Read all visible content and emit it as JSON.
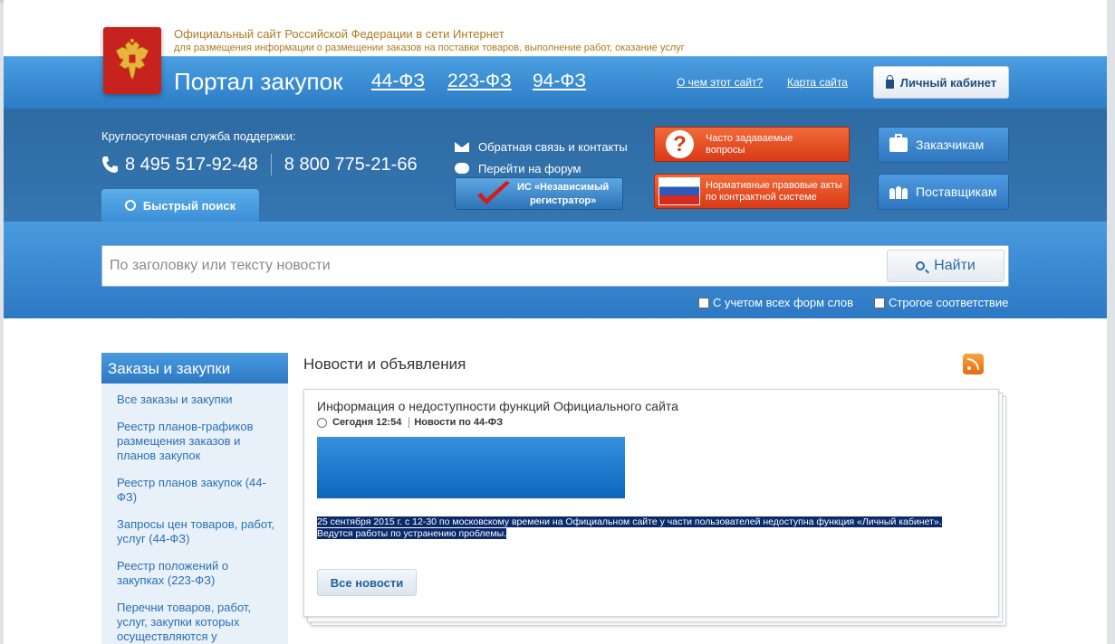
{
  "header": {
    "official_line1": "Официальный сайт Российской Федерации в сети Интернет",
    "official_line2": "для размещения информации о размещении заказов на поставки товаров, выполнение работ, оказание услуг",
    "portal_title": "Портал закупок",
    "laws": [
      "44-ФЗ",
      "223-ФЗ",
      "94-ФЗ"
    ],
    "about_link": "О чем этот сайт?",
    "sitemap_link": "Карта сайта",
    "cabinet_label": "Личный кабинет"
  },
  "support": {
    "label": "Круглосуточная служба поддержки:",
    "phone1": "8 495 517-92-48",
    "phone2": "8 800 775-21-66",
    "quick_search_tab": "Быстрый поиск"
  },
  "mid_links": {
    "feedback": "Обратная связь и контакты",
    "forum": "Перейти на форум",
    "registrar_line1": "ИС «Независимый",
    "registrar_line2": "регистратор»"
  },
  "red_buttons": {
    "faq_line1": "Часто задаваемые",
    "faq_line2": "вопросы",
    "acts_line1": "Нормативные правовые акты",
    "acts_line2": "по контрактной системе"
  },
  "side_buttons": {
    "customers": "Заказчикам",
    "suppliers": "Поставщикам"
  },
  "search": {
    "placeholder": "По заголовку или тексту новости",
    "value": "",
    "find_label": "Найти",
    "opt_wordforms": "С учетом всех форм слов",
    "opt_strict": "Строгое соответствие"
  },
  "left_menu": {
    "title": "Заказы и закупки",
    "items": [
      "Все заказы и закупки",
      "Реестр планов-графиков размещения заказов и планов закупок",
      "Реестр планов закупок (44-ФЗ)",
      "Запросы цен товаров, работ, услуг (44-ФЗ)",
      "Реестр положений о закупках (223-ФЗ)",
      "Перечни товаров, работ, услуг, закупки которых осуществляются у"
    ]
  },
  "news": {
    "section_title": "Новости и объявления",
    "item_title": "Информация о недоступности функций Официального сайта",
    "time": "Сегодня 12:54",
    "category": "Новости по 44-ФЗ",
    "body_line1": "25 сентября 2015 г. с 12-30 по московскому времени на Официальном сайте у части пользователей недоступна функция «Личный кабинет».",
    "body_line2": "Ведутся работы по устранению проблемы.",
    "all_news_label": "Все новости"
  },
  "colors": {
    "brand_blue": "#2d78c3",
    "dark_blue": "#2f6fa8",
    "accent_red": "#d93a17",
    "link_blue": "#2a6fb5",
    "gold_text": "#b07a1e"
  }
}
